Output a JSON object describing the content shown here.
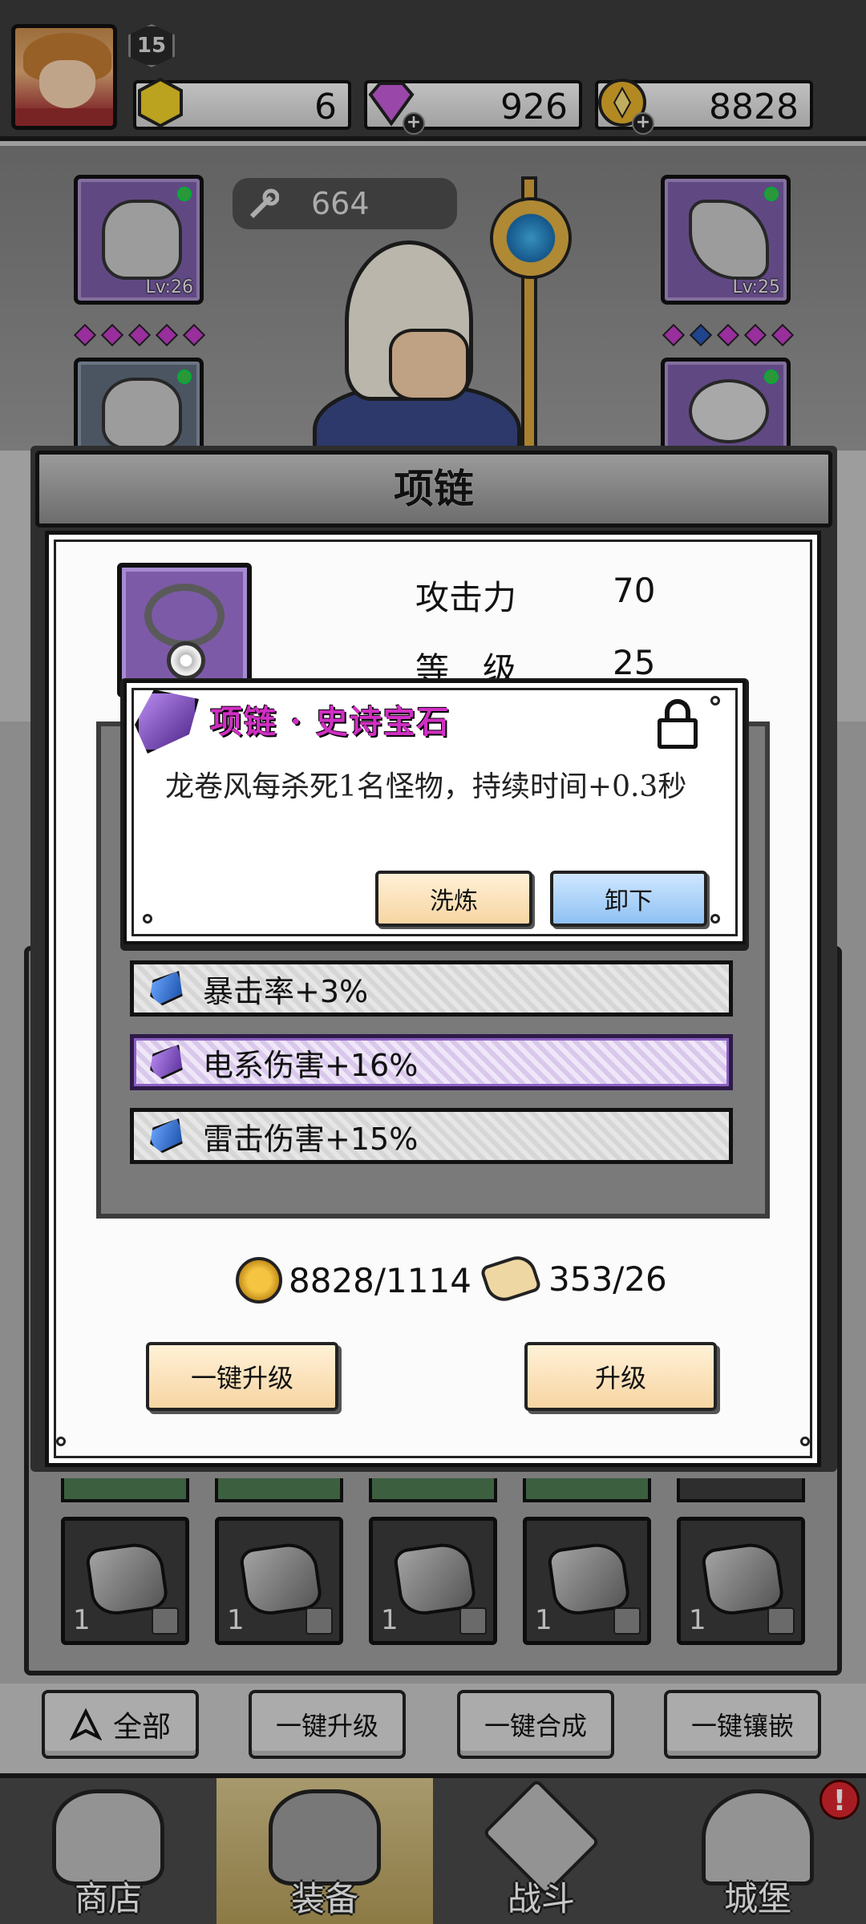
{
  "topbar": {
    "level": "15",
    "resources": [
      {
        "name": "energy",
        "value": "6",
        "color": "#f0d028"
      },
      {
        "name": "gems",
        "value": "926",
        "color": "#c45bd8"
      },
      {
        "name": "gold",
        "value": "8828",
        "color": "#e6b02c"
      }
    ]
  },
  "character": {
    "power": "664",
    "left_slot_top_level": "Lv:26",
    "right_slot_top_level": "Lv:25"
  },
  "modal": {
    "title": "项链",
    "stats": [
      {
        "label": "攻击力",
        "value": "70"
      },
      {
        "label": "等　级",
        "value": "25"
      }
    ],
    "gem_rows": [
      {
        "text": "暴击率+3%",
        "gem_color": "blue"
      },
      {
        "text": "电系伤害+16%",
        "gem_color": "violet"
      },
      {
        "text": "雷击伤害+15%",
        "gem_color": "blue"
      }
    ],
    "cost_gold": "8828/1114",
    "cost_scroll": "353/26",
    "btn_upgrade_all": "一键升级",
    "btn_upgrade": "升级"
  },
  "tooltip": {
    "title": "项链 · 史诗宝石",
    "description": "龙卷风每杀死1名怪物，持续时间+0.3秒",
    "btn_reroll": "洗炼",
    "btn_unequip": "卸下"
  },
  "inventory": {
    "items": [
      {
        "count": "1"
      },
      {
        "count": "1"
      },
      {
        "count": "1"
      },
      {
        "count": "1"
      },
      {
        "count": "1"
      }
    ]
  },
  "actions": {
    "filter_all": "全部",
    "upgrade_all": "一键升级",
    "merge_all": "一键合成",
    "inlay_all": "一键镶嵌"
  },
  "nav": {
    "tabs": [
      {
        "label": "商店"
      },
      {
        "label": "装备"
      },
      {
        "label": "战斗"
      },
      {
        "label": "城堡"
      }
    ],
    "alert": "!"
  }
}
